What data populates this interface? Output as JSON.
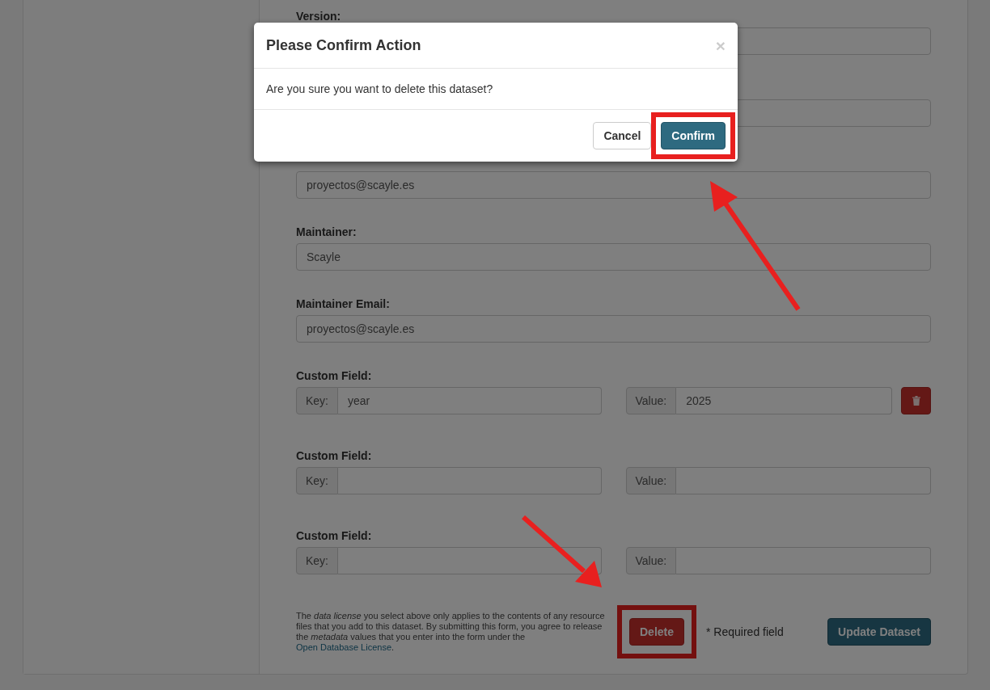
{
  "form": {
    "fields": [
      {
        "kind": "text",
        "label": "Version:"
      },
      {
        "kind": "text"
      },
      {
        "kind": "text",
        "value": "proyectos@scayle.es"
      },
      {
        "kind": "text",
        "label": "Maintainer:",
        "value": "Scayle"
      },
      {
        "kind": "text",
        "label": "Maintainer Email:",
        "value": "proyectos@scayle.es"
      }
    ],
    "custom_fields": [
      {
        "label": "Custom Field:",
        "key_label": "Key:",
        "key": "year",
        "value_label": "Value:",
        "value": "2025",
        "removable": true
      },
      {
        "label": "Custom Field:",
        "key_label": "Key:",
        "value_label": "Value:",
        "removable": false
      },
      {
        "label": "Custom Field:",
        "key_label": "Key:",
        "value_label": "Value:",
        "removable": false
      }
    ],
    "license_text_before": "The *data license* you select above only applies to the contents of any resource files that you add to this dataset. By submitting this form, you agree to release the *metadata* values that you enter into the form under the ",
    "license_link": "Open Database License",
    "license_text_after": ".",
    "delete_button": {
      "label": "Delete",
      "highlighted": true
    },
    "required_note": "* Required field",
    "submit_button": {
      "label": "Update Dataset"
    }
  },
  "modal": {
    "title": "Please Confirm Action",
    "close": "×",
    "message": "Are you sure you want to delete this dataset?",
    "buttons": [
      {
        "label": "Cancel",
        "kind": "default",
        "highlighted": false
      },
      {
        "label": "Confirm",
        "kind": "primary",
        "highlighted": true
      }
    ]
  }
}
